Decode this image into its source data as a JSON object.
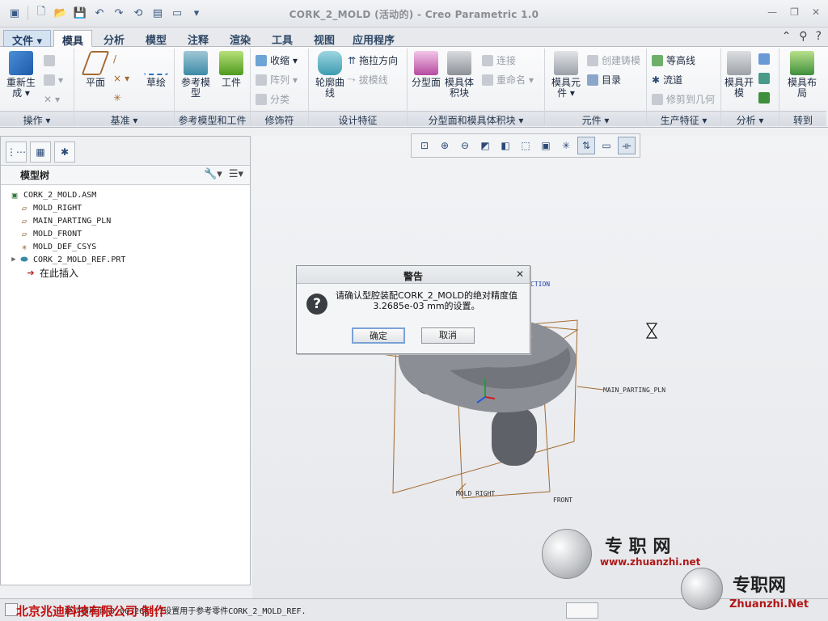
{
  "window": {
    "title": "CORK_2_MOLD (活动的) - Creo Parametric 1.0"
  },
  "menu_tabs": [
    {
      "label": "文件",
      "kind": "file"
    },
    {
      "label": "模具",
      "kind": "active"
    },
    {
      "label": "分析",
      "kind": "normal"
    },
    {
      "label": "模型",
      "kind": "normal"
    },
    {
      "label": "注释",
      "kind": "normal"
    },
    {
      "label": "渲染",
      "kind": "normal"
    },
    {
      "label": "工具",
      "kind": "normal"
    },
    {
      "label": "视图",
      "kind": "normal"
    },
    {
      "label": "应用程序",
      "kind": "normal"
    }
  ],
  "ribbon": {
    "groups": {
      "operations": "操作",
      "datum": "基准",
      "ref_model": "参考模型和工件",
      "cosmetic": "修饰符",
      "design_feature": "设计特征",
      "parting": "分型面和模具体积块",
      "components": "元件",
      "production": "生产特征",
      "analysis": "分析",
      "goto": "转到"
    },
    "buttons": {
      "regenerate": "重新生成",
      "plane": "平面",
      "sketch": "草绘",
      "ref_model": "参考模型",
      "workpiece": "工件",
      "shrink": "收缩",
      "pattern": "阵列",
      "classify": "分类",
      "silhouette": "轮廓曲线",
      "drag_dir": "拖拉方向",
      "draft_line": "拔模线",
      "parting_surface": "分型面",
      "mold_volume": "模具体积块",
      "connect": "连接",
      "rename": "重命名",
      "mold_component": "模具元件",
      "create_casting": "创建铸模",
      "catalog": "目录",
      "contour_line": "等高线",
      "runner": "流道",
      "trim_geometry": "修剪到几何",
      "mold_open": "模具开模",
      "mold_layout": "模具布局"
    }
  },
  "tree": {
    "header": "模型树",
    "items": [
      {
        "label": "CORK_2_MOLD.ASM",
        "icon": "assembly-icon",
        "expander": ""
      },
      {
        "label": "MOLD_RIGHT",
        "icon": "datum-plane-icon",
        "expander": ""
      },
      {
        "label": "MAIN_PARTING_PLN",
        "icon": "datum-plane-icon",
        "expander": ""
      },
      {
        "label": "MOLD_FRONT",
        "icon": "datum-plane-icon",
        "expander": ""
      },
      {
        "label": "MOLD_DEF_CSYS",
        "icon": "csys-icon",
        "expander": ""
      },
      {
        "label": "CORK_2_MOLD_REF.PRT",
        "icon": "part-icon",
        "expander": "▶"
      },
      {
        "label": "在此插入",
        "icon": "insert-here-icon",
        "expander": ""
      }
    ]
  },
  "viewport": {
    "labels": {
      "main_parting_pln": "MAIN_PARTING_PLN",
      "mold_right": "MOLD_RIGHT",
      "front": "FRONT",
      "ction": "CTION"
    }
  },
  "dialog": {
    "title": "警告",
    "message_line1": "请确认型腔装配CORK_2_MOLD的绝对精度值",
    "message_line2": "3.2685e-03 mm的设置。",
    "ok": "确定",
    "cancel": "取消"
  },
  "status": {
    "message": "绝对精度值 0.003268517设置用于参考零件CORK_2_MOLD_REF.",
    "credit": "北京兆迪科技有限公司    制作"
  },
  "watermarks": {
    "wm1_title": "专 职 网",
    "wm1_url": "www.zhuanzhi.net",
    "wm2_title": "专职网",
    "wm2_url": "Zhuanzhi.Net"
  },
  "colors": {
    "datum": "#a4692e",
    "part": "#8b8f95",
    "accent": "#2f4866",
    "credit_red": "#c41010"
  }
}
